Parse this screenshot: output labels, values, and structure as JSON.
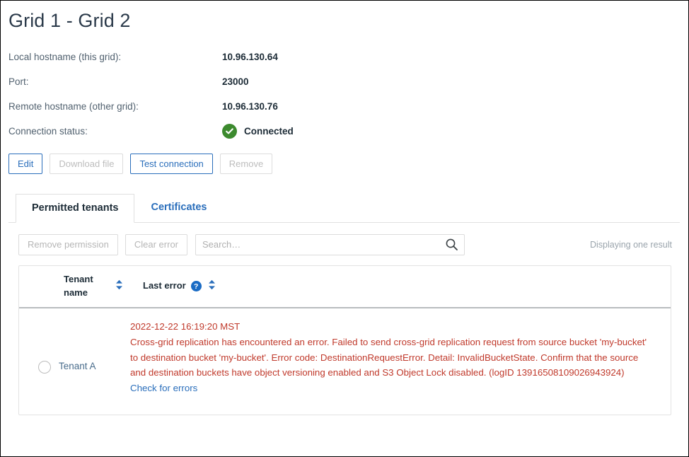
{
  "header": {
    "title": "Grid 1 - Grid 2"
  },
  "details": [
    {
      "label": "Local hostname (this grid):",
      "value": "10.96.130.64"
    },
    {
      "label": "Port:",
      "value": "23000"
    },
    {
      "label": "Remote hostname (other grid):",
      "value": "10.96.130.76"
    }
  ],
  "connection": {
    "label": "Connection status:",
    "status": "Connected",
    "status_color": "#3c8a2e",
    "icon": "check-circle-icon"
  },
  "actions": [
    {
      "label": "Edit",
      "enabled": true
    },
    {
      "label": "Download file",
      "enabled": false
    },
    {
      "label": "Test connection",
      "enabled": true
    },
    {
      "label": "Remove",
      "enabled": false
    }
  ],
  "tabs": [
    {
      "label": "Permitted tenants",
      "active": true
    },
    {
      "label": "Certificates",
      "active": false
    }
  ],
  "toolbar": {
    "remove_permission_label": "Remove permission",
    "clear_error_label": "Clear error",
    "search_placeholder": "Search…",
    "search_value": "",
    "search_icon": "search-icon",
    "result_count": "Displaying one result"
  },
  "table": {
    "columns": {
      "tenant_name": "Tenant name",
      "last_error": "Last error"
    },
    "rows": [
      {
        "selected": false,
        "tenant_name": "Tenant A",
        "error_time": "2022-12-22 16:19:20 MST",
        "error_message": "Cross-grid replication has encountered an error. Failed to send cross-grid replication request from source bucket 'my-bucket' to destination bucket 'my-bucket'. Error code: DestinationRequestError. Detail: InvalidBucketState. Confirm that the source and destination buckets have object versioning enabled and S3 Object Lock disabled. (logID 13916508109026943924)",
        "error_link": "Check for errors"
      }
    ]
  },
  "colors": {
    "accent_blue": "#2a6ebb",
    "error_red": "#c0392b",
    "success_green": "#3c8a2e",
    "title_text": "#2b3a4a"
  }
}
